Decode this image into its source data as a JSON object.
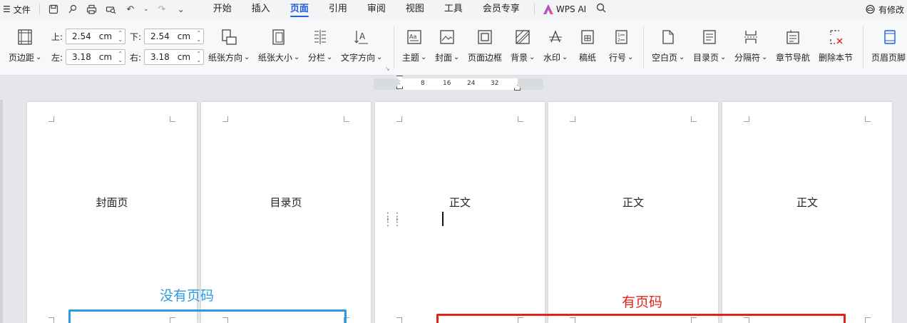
{
  "menubar": {
    "file_label": "文件",
    "tabs": [
      "开始",
      "插入",
      "页面",
      "引用",
      "审阅",
      "视图",
      "工具",
      "会员专享"
    ],
    "active_tab": "页面",
    "wps_ai": "WPS AI",
    "right_label": "有修改"
  },
  "ribbon": {
    "margins_label": "页边距",
    "top_label": "上:",
    "top_value": "2.54",
    "bottom_label": "下:",
    "bottom_value": "2.54",
    "left_label": "左:",
    "left_value": "3.18",
    "right_label": "右:",
    "right_value": "3.18",
    "unit": "cm",
    "orientation": "纸张方向",
    "size": "纸张大小",
    "columns": "分栏",
    "text_direction": "文字方向",
    "theme": "主题",
    "cover": "封面",
    "page_border": "页面边框",
    "background": "背景",
    "watermark": "水印",
    "manuscript": "稿纸",
    "line_number": "行号",
    "blank_page": "空白页",
    "toc_page": "目录页",
    "separator": "分隔符",
    "chapter_nav": "章节导航",
    "delete_section": "删除本节",
    "header_footer": "页眉页脚"
  },
  "ruler": {
    "ticks": [
      "8",
      "16",
      "24",
      "32"
    ]
  },
  "pages": [
    {
      "text": "封面页"
    },
    {
      "text": "目录页"
    },
    {
      "text": "正文"
    },
    {
      "text": "正文"
    },
    {
      "text": "正文"
    }
  ],
  "annotations": {
    "no_page_number": "没有页码",
    "has_page_number": "有页码",
    "blue_color": "#2b9be0",
    "red_color": "#e2231a"
  }
}
